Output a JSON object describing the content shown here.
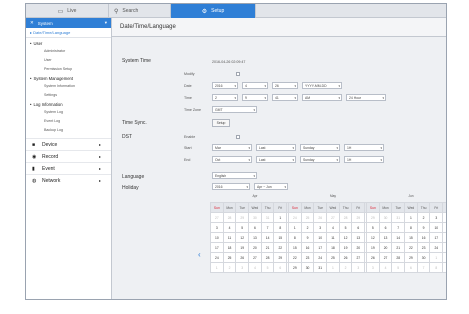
{
  "tabs": [
    {
      "label": "Live",
      "icon": "monitor-icon"
    },
    {
      "label": "Search",
      "icon": "search-icon"
    },
    {
      "label": "Setup",
      "icon": "gear-icon"
    }
  ],
  "sidebar": {
    "header": "System",
    "active_item": "Date/Time/Language",
    "groups": [
      {
        "label": "User",
        "items": [
          "Administrator",
          "User",
          "Permission Setup"
        ]
      },
      {
        "label": "System Management",
        "items": [
          "System Information",
          "Settings"
        ]
      },
      {
        "label": "Log Information",
        "items": [
          "System Log",
          "Event Log",
          "Backup Log"
        ]
      }
    ],
    "main_items": [
      {
        "label": "Device",
        "icon": "camera-icon"
      },
      {
        "label": "Record",
        "icon": "record-icon"
      },
      {
        "label": "Event",
        "icon": "event-icon"
      },
      {
        "label": "Network",
        "icon": "network-icon"
      }
    ]
  },
  "content": {
    "title": "Date/Time/Language",
    "system_time_label": "System Time",
    "system_time_value": "2016-04-26 02:09:47",
    "modify_label": "Modify",
    "date_label": "Date",
    "date_year": "2016",
    "date_month": "4",
    "date_day": "26",
    "date_format": "YYYY-MM-DD",
    "time_label": "Time",
    "time_hour": "2",
    "time_min": "9",
    "time_sec": "41",
    "time_ampm": "AM",
    "time_format": "24 Hour",
    "timezone_label": "Time Zone",
    "timezone_value": "GMT",
    "timesync_label": "Time Sync.",
    "setup_button": "Setup",
    "dst_label": "DST",
    "enable_label": "Enable",
    "start_label": "Start",
    "start_month": "Mar",
    "start_week": "Last",
    "start_day": "Sunday",
    "start_hour": "1H",
    "end_label": "End",
    "end_month": "Oct",
    "end_week": "Last",
    "end_day": "Sunday",
    "end_hour": "1H",
    "language_label": "Language",
    "language_value": "English",
    "holiday_label": "Holiday",
    "holiday_year": "2016",
    "holiday_range": "Apr ~ Jun"
  },
  "calendar": {
    "weekdays": [
      "Sun",
      "Mon",
      "Tue",
      "Wed",
      "Thu",
      "Fri",
      "Sat"
    ],
    "months": [
      {
        "name": "Apr",
        "days": [
          "27",
          "28",
          "29",
          "30",
          "31",
          "1",
          "2",
          "3",
          "4",
          "5",
          "6",
          "7",
          "8",
          "9",
          "10",
          "11",
          "12",
          "13",
          "14",
          "15",
          "16",
          "17",
          "18",
          "19",
          "20",
          "21",
          "22",
          "23",
          "24",
          "25",
          "26",
          "27",
          "28",
          "29",
          "30",
          "1",
          "2",
          "3",
          "4",
          "5",
          "6",
          "7"
        ],
        "lead": 5,
        "count": 30
      },
      {
        "name": "May",
        "days": [
          "24",
          "25",
          "26",
          "27",
          "28",
          "29",
          "30",
          "1",
          "2",
          "3",
          "4",
          "5",
          "6",
          "7",
          "8",
          "9",
          "10",
          "11",
          "12",
          "13",
          "14",
          "15",
          "16",
          "17",
          "18",
          "19",
          "20",
          "21",
          "22",
          "23",
          "24",
          "25",
          "26",
          "27",
          "28",
          "29",
          "30",
          "31",
          "1",
          "2",
          "3",
          "4"
        ],
        "lead": 7,
        "count": 31
      },
      {
        "name": "Jun",
        "days": [
          "29",
          "30",
          "31",
          "1",
          "2",
          "3",
          "4",
          "5",
          "6",
          "7",
          "8",
          "9",
          "10",
          "11",
          "12",
          "13",
          "14",
          "15",
          "16",
          "17",
          "18",
          "19",
          "20",
          "21",
          "22",
          "23",
          "24",
          "25",
          "26",
          "27",
          "28",
          "29",
          "30",
          "1",
          "2",
          "3",
          "4",
          "5",
          "6",
          "7",
          "8",
          "9"
        ],
        "lead": 3,
        "count": 30
      }
    ],
    "prev_icon": "chevron-left-icon",
    "next_icon": "chevron-right-icon"
  }
}
